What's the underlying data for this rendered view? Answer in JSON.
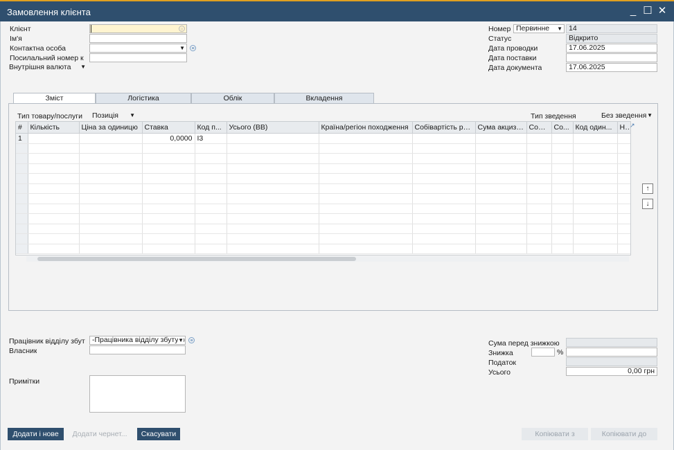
{
  "window": {
    "title": "Замовлення клієнта",
    "minimize": "_",
    "maximize": "☐",
    "close": "✕"
  },
  "header_left": {
    "client_label": "Клієнт",
    "name_label": "Ім'я",
    "contact_label": "Контактна особа",
    "ref_label": "Посилальний номер к",
    "currency_value": "Внутрішня валюта"
  },
  "header_right": {
    "number_label": "Номер",
    "series_value": "Первинне",
    "number_value": "14",
    "status_label": "Статус",
    "status_value": "Відкрито",
    "posting_date_label": "Дата проводки",
    "posting_date_value": "17.06.2025",
    "delivery_date_label": "Дата поставки",
    "delivery_date_value": "",
    "doc_date_label": "Дата документа",
    "doc_date_value": "17.06.2025"
  },
  "tabs": [
    {
      "label": "Зміст"
    },
    {
      "label": "Логістика"
    },
    {
      "label": "Облік"
    },
    {
      "label": "Вкладення"
    }
  ],
  "contents": {
    "item_type_label": "Тип товару/послуги",
    "item_type_value": "Позиція",
    "summary_label": "Тип зведення",
    "summary_value": "Без зведення"
  },
  "grid": {
    "columns": [
      "#",
      "Кількість",
      "Ціна за одиницю",
      "Ставка",
      "Код п...",
      "Усього (ВВ)",
      "Країна/регіон походження",
      "Собівартість реа...",
      "Сума акцизн...",
      "Собі...",
      "Со...",
      "Код один...",
      "Н..."
    ],
    "rows": [
      [
        "1",
        "",
        "",
        "0,0000",
        "І3",
        "",
        "",
        "",
        "",
        "",
        "",
        "",
        ""
      ]
    ]
  },
  "footer_left": {
    "sales_employee_label": "Працівник відділу збут",
    "sales_employee_value": "-Працівника відділу збуту нем",
    "owner_label": "Власник",
    "remarks_label": "Примітки"
  },
  "footer_right": {
    "before_discount_label": "Сума перед знижкою",
    "discount_label": "Знижка",
    "percent": "%",
    "tax_label": "Податок",
    "total_label": "Усього",
    "total_value": "0,00 грн"
  },
  "buttons": {
    "add_new": "Додати і нове",
    "add_draft": "Додати чернет...",
    "cancel": "Скасувати",
    "copy_from": "Копіювати з",
    "copy_to": "Копіювати до"
  }
}
